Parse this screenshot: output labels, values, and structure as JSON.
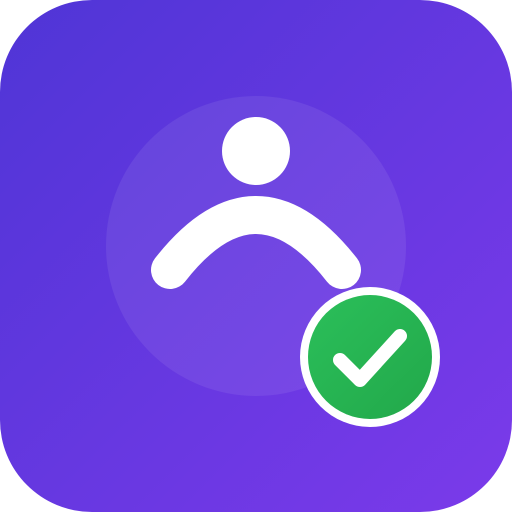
{
  "icon": {
    "type": "app-icon",
    "symbol": "user-verified",
    "background": {
      "gradient_start": "#4F35D6",
      "gradient_end": "#7B3AEA",
      "halo_color": "#FFFFFF"
    },
    "person_color": "#FFFFFF",
    "badge": {
      "symbol": "checkmark",
      "fill": "#22A84A",
      "fill_light": "#2BBF5A",
      "ring_color": "#FFFFFF",
      "check_color": "#FFFFFF"
    }
  }
}
